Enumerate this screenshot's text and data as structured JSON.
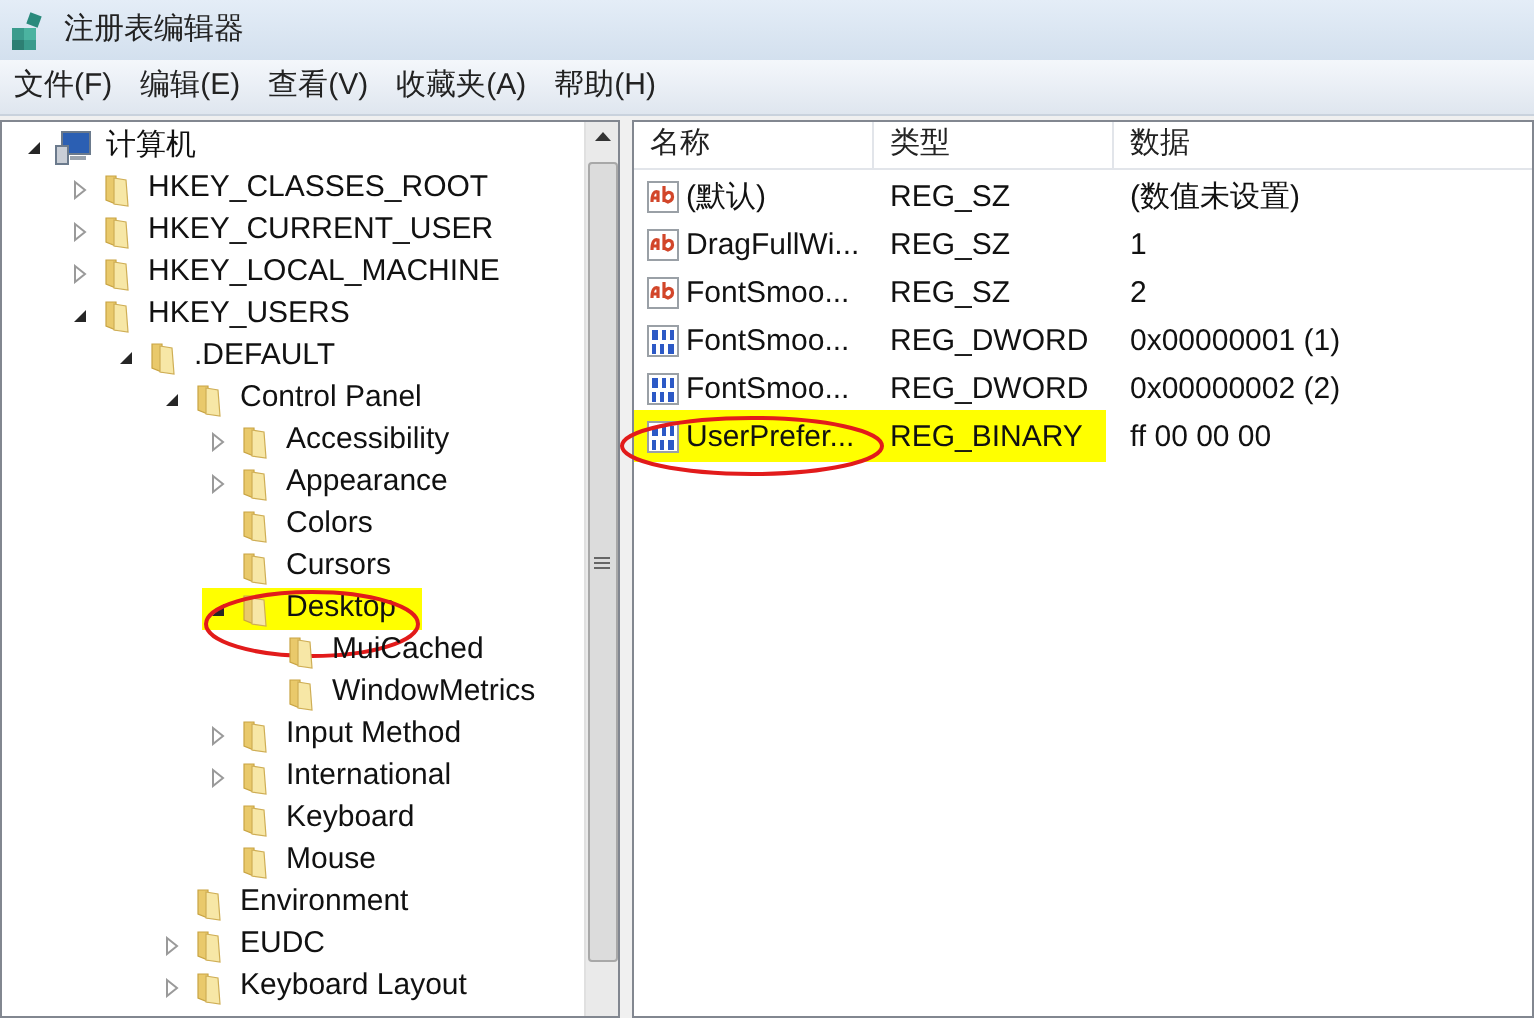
{
  "window": {
    "title": "注册表编辑器"
  },
  "menu": [
    "文件(F)",
    "编辑(E)",
    "查看(V)",
    "收藏夹(A)",
    "帮助(H)"
  ],
  "tree": {
    "label": "计算机",
    "kind": "computer",
    "expanded": true,
    "children": [
      {
        "label": "HKEY_CLASSES_ROOT",
        "expanded": false
      },
      {
        "label": "HKEY_CURRENT_USER",
        "expanded": false
      },
      {
        "label": "HKEY_LOCAL_MACHINE",
        "expanded": false
      },
      {
        "label": "HKEY_USERS",
        "expanded": true,
        "children": [
          {
            "label": ".DEFAULT",
            "expanded": true,
            "children": [
              {
                "label": "Control Panel",
                "expanded": true,
                "children": [
                  {
                    "label": "Accessibility",
                    "expanded": false
                  },
                  {
                    "label": "Appearance",
                    "expanded": false
                  },
                  {
                    "label": "Colors"
                  },
                  {
                    "label": "Cursors"
                  },
                  {
                    "label": "Desktop",
                    "expanded": true,
                    "highlighted": true,
                    "circled": true,
                    "children": [
                      {
                        "label": "MuiCached"
                      },
                      {
                        "label": "WindowMetrics"
                      }
                    ]
                  },
                  {
                    "label": "Input Method",
                    "expanded": false
                  },
                  {
                    "label": "International",
                    "expanded": false
                  },
                  {
                    "label": "Keyboard"
                  },
                  {
                    "label": "Mouse"
                  }
                ]
              },
              {
                "label": "Environment"
              },
              {
                "label": "EUDC",
                "expanded": false
              },
              {
                "label": "Keyboard Layout",
                "expanded": false
              }
            ]
          }
        ]
      }
    ]
  },
  "columns": [
    "名称",
    "类型",
    "数据"
  ],
  "values": [
    {
      "kind": "string",
      "name": "(默认)",
      "type": "REG_SZ",
      "data": "(数值未设置)",
      "highlighted": false,
      "circled": false
    },
    {
      "kind": "string",
      "name": "DragFullWi...",
      "type": "REG_SZ",
      "data": "1",
      "highlighted": false,
      "circled": false
    },
    {
      "kind": "string",
      "name": "FontSmoo...",
      "type": "REG_SZ",
      "data": "2",
      "highlighted": false,
      "circled": false
    },
    {
      "kind": "binary",
      "name": "FontSmoo...",
      "type": "REG_DWORD",
      "data": "0x00000001 (1)",
      "highlighted": false,
      "circled": false
    },
    {
      "kind": "binary",
      "name": "FontSmoo...",
      "type": "REG_DWORD",
      "data": "0x00000002 (2)",
      "highlighted": false,
      "circled": false
    },
    {
      "kind": "binary",
      "name": "UserPrefer...",
      "type": "REG_BINARY",
      "data": "ff 00 00 00",
      "highlighted": true,
      "circled": true
    }
  ]
}
